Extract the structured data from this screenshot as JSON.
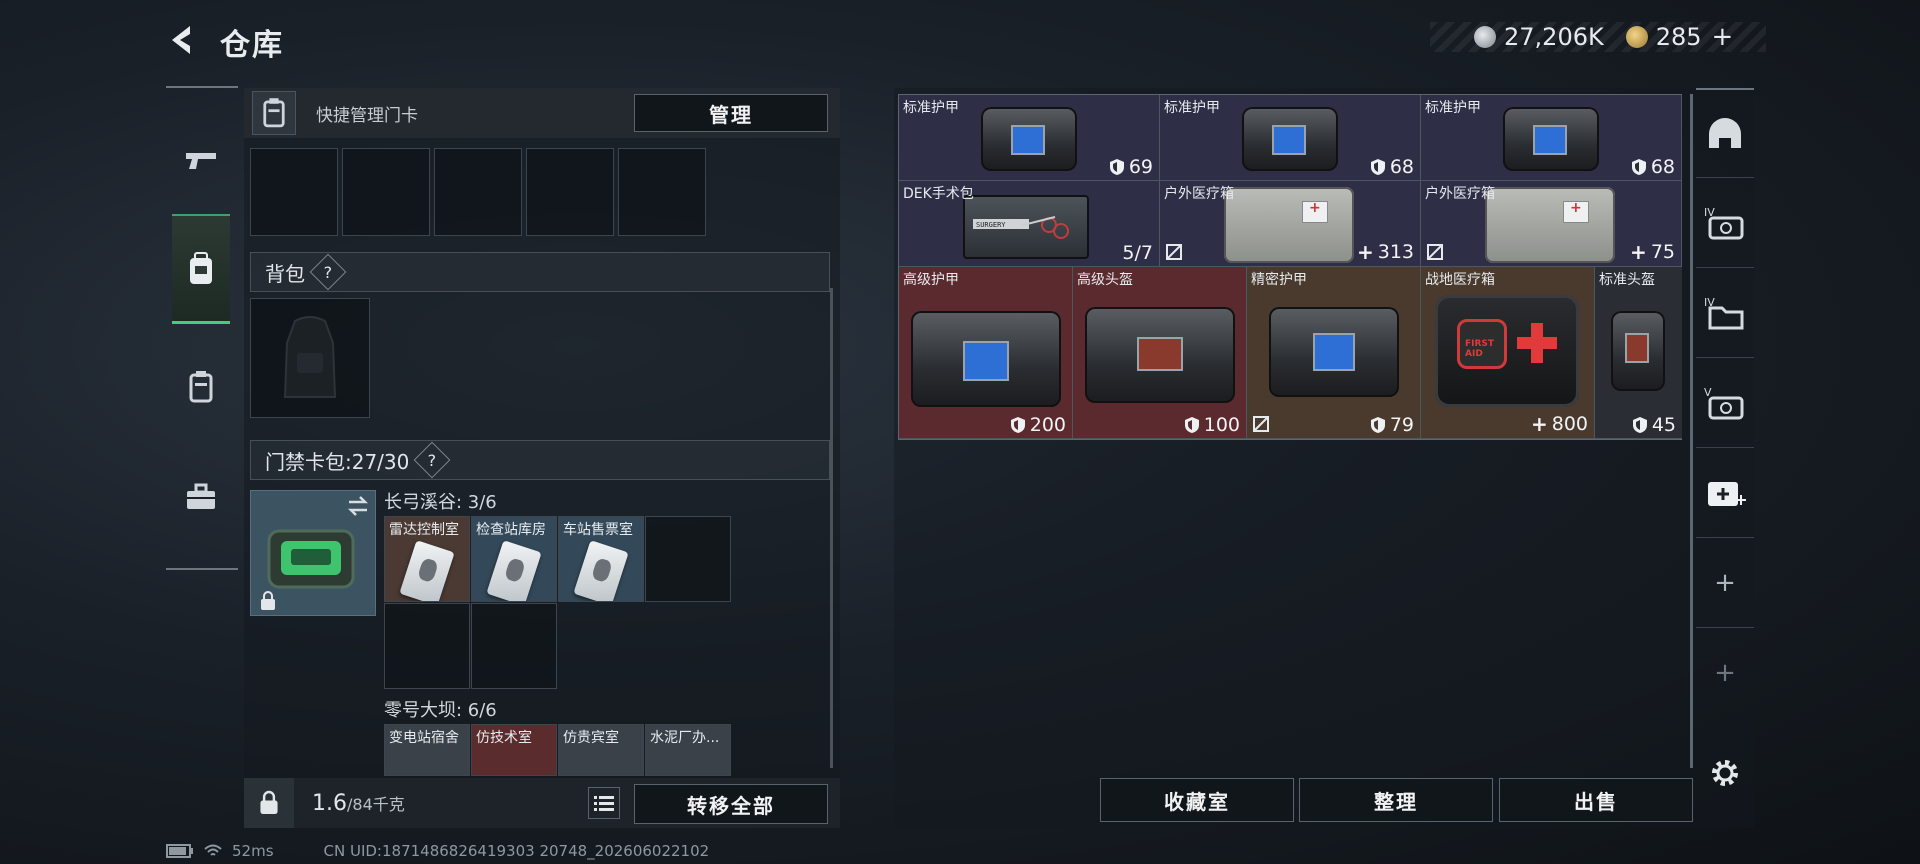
{
  "header": {
    "title": "仓库",
    "currency_primary": "27,206K",
    "currency_secondary": "285",
    "plus_glyph": "+"
  },
  "left": {
    "quick_label": "快捷管理门卡",
    "manage_button": "管理",
    "backpack_section": "背包",
    "keycard_section": "门禁卡包:27/30",
    "help_glyph": "?",
    "zone1_title": "长弓溪谷: 3/6",
    "zone1_cards": [
      "雷达控制室",
      "检查站库房",
      "车站售票室"
    ],
    "zone2_title": "零号大坝: 6/6",
    "zone2_cards": [
      "变电站宿舍",
      "仿技术室",
      "仿贵宾室",
      "水泥厂办..."
    ],
    "weight_value": "1.6",
    "weight_capacity": "/84千克",
    "transfer_button": "转移全部"
  },
  "items": [
    {
      "name": "标准护甲",
      "value": "69",
      "kind": "armor"
    },
    {
      "name": "标准护甲",
      "value": "68",
      "kind": "armor"
    },
    {
      "name": "标准护甲",
      "value": "68",
      "kind": "armor"
    },
    {
      "name": "DEK手术包",
      "value": "5/7",
      "kind": "count"
    },
    {
      "name": "户外医疗箱",
      "value": "313",
      "kind": "heal"
    },
    {
      "name": "户外医疗箱",
      "value": "75",
      "kind": "heal"
    },
    {
      "name": "高级护甲",
      "value": "200",
      "kind": "armor"
    },
    {
      "name": "高级头盔",
      "value": "100",
      "kind": "armor"
    },
    {
      "name": "精密护甲",
      "value": "79",
      "kind": "armor"
    },
    {
      "name": "战地医疗箱",
      "value": "800",
      "kind": "heal"
    },
    {
      "name": "标准头盔",
      "value": "45",
      "kind": "armor"
    }
  ],
  "firstaid_label": "FIRST AID",
  "surgery_label": "SURGERY",
  "bottom_buttons": {
    "collection": "收藏室",
    "organize": "整理",
    "sell": "出售"
  },
  "tools": {
    "iv_label": "IV",
    "v_label": "V",
    "plus_glyph": "+"
  },
  "status": {
    "ping": "52ms",
    "uid": "CN UID:1871486826419303 20748_202606022102"
  },
  "colors": {
    "accent_green": "#3fcf7f",
    "rarity_purple": "#2e2f46",
    "rarity_red": "#5b2a2e",
    "rarity_brown": "#4a3a2e"
  }
}
